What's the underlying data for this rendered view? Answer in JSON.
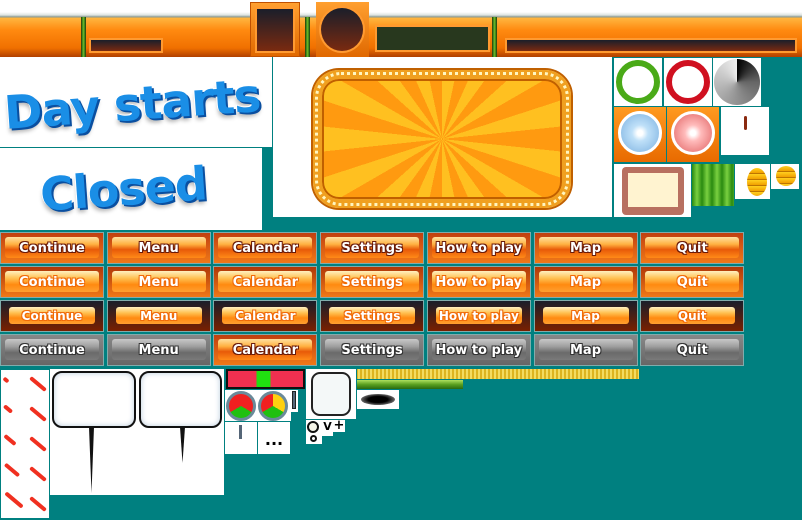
{
  "text_sprites": {
    "day_starts": "Day starts",
    "closed": "Closed"
  },
  "buttons": {
    "labels": [
      "Continue",
      "Menu",
      "Calendar",
      "Settings",
      "How to play",
      "Map",
      "Quit"
    ],
    "rows": [
      {
        "state": "normal",
        "styles": [
          "s0",
          "s0",
          "s0",
          "s0",
          "s0",
          "s0",
          "s0"
        ]
      },
      {
        "state": "hover",
        "styles": [
          "s1",
          "s1",
          "s1",
          "s1",
          "s1",
          "s1",
          "s1"
        ]
      },
      {
        "state": "pressed",
        "styles": [
          "s2",
          "s2",
          "s2",
          "s2",
          "s2",
          "s2",
          "s2"
        ]
      },
      {
        "state": "disabled",
        "styles": [
          "s3",
          "s3",
          "s0",
          "s3",
          "s3",
          "s3",
          "s3"
        ]
      }
    ]
  },
  "misc": {
    "ellipsis": "...",
    "plus": "+",
    "v": "V"
  },
  "colors": {
    "background": "#008080",
    "orange": "#ff8a10",
    "green": "#3ac010",
    "red": "#e01020"
  },
  "icons": [
    "green-ring-icon",
    "red-ring-icon",
    "pie-timer-icon",
    "blue-clock-icon",
    "red-clock-icon",
    "candle-icon",
    "tray-icon",
    "green-curtain-icon",
    "coin-stack-large-icon",
    "coin-stack-small-icon",
    "red-pen-mark-icon",
    "speech-bubble-icon",
    "meter-icon",
    "timer-gauge-icon",
    "ellipsis-icon",
    "gold-bar-icon",
    "green-bar-icon",
    "shadow-icon"
  ]
}
